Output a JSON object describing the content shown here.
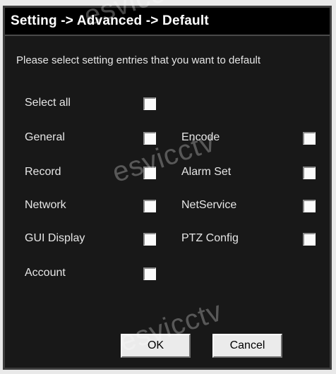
{
  "window": {
    "title": "Setting -> Advanced -> Default"
  },
  "prompt": "Please select setting entries that you want to default",
  "select_all": {
    "label": "Select all",
    "checked": false
  },
  "entries_left": [
    {
      "label": "General",
      "checked": false
    },
    {
      "label": "Record",
      "checked": false
    },
    {
      "label": "Network",
      "checked": false
    },
    {
      "label": "GUI Display",
      "checked": false
    },
    {
      "label": "Account",
      "checked": false
    }
  ],
  "entries_right": [
    {
      "label": "Encode",
      "checked": false
    },
    {
      "label": "Alarm Set",
      "checked": false
    },
    {
      "label": "NetService",
      "checked": false
    },
    {
      "label": "PTZ Config",
      "checked": false
    }
  ],
  "buttons": {
    "ok": "OK",
    "cancel": "Cancel"
  },
  "watermark": "esvicctv",
  "colors": {
    "background": "#181818",
    "titlebar": "#000000",
    "text": "#e6e6e6",
    "button": "#ebebeb"
  }
}
